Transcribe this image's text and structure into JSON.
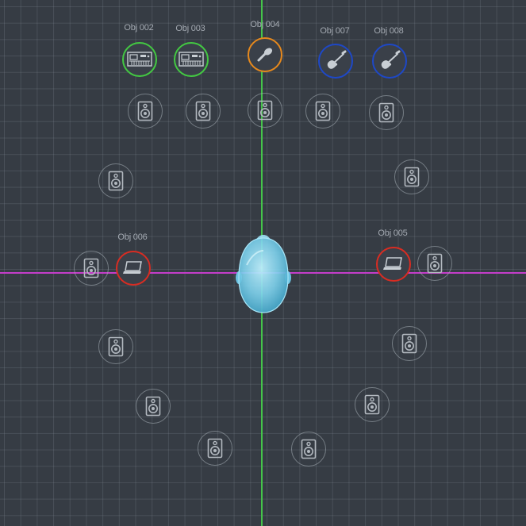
{
  "colors": {
    "axis_vertical": "#45c44a",
    "axis_horizontal": "#c43dc9",
    "speaker": "#b3b9c0",
    "listener": "#7fd3ee",
    "ring_green": "#43c942",
    "ring_orange": "#e7891c",
    "ring_blue": "#1e48c7",
    "ring_red": "#d92c22",
    "label": "#a4aab2"
  },
  "objects": [
    {
      "id": "obj-002",
      "label": "Obj 002",
      "icon": "keyboard-icon",
      "ring": "green"
    },
    {
      "id": "obj-003",
      "label": "Obj 003",
      "icon": "keyboard-icon",
      "ring": "green"
    },
    {
      "id": "obj-004",
      "label": "Obj 004",
      "icon": "microphone-icon",
      "ring": "orange"
    },
    {
      "id": "obj-007",
      "label": "Obj 007",
      "icon": "guitar-icon",
      "ring": "blue"
    },
    {
      "id": "obj-008",
      "label": "Obj 008",
      "icon": "guitar-icon",
      "ring": "blue"
    },
    {
      "id": "obj-006",
      "label": "Obj 006",
      "icon": "laptop-icon",
      "ring": "red"
    },
    {
      "id": "obj-005",
      "label": "Obj 005",
      "icon": "laptop-icon",
      "ring": "red"
    }
  ],
  "speakers_icon": "speaker-icon",
  "listener_icon": "listener-head-icon"
}
